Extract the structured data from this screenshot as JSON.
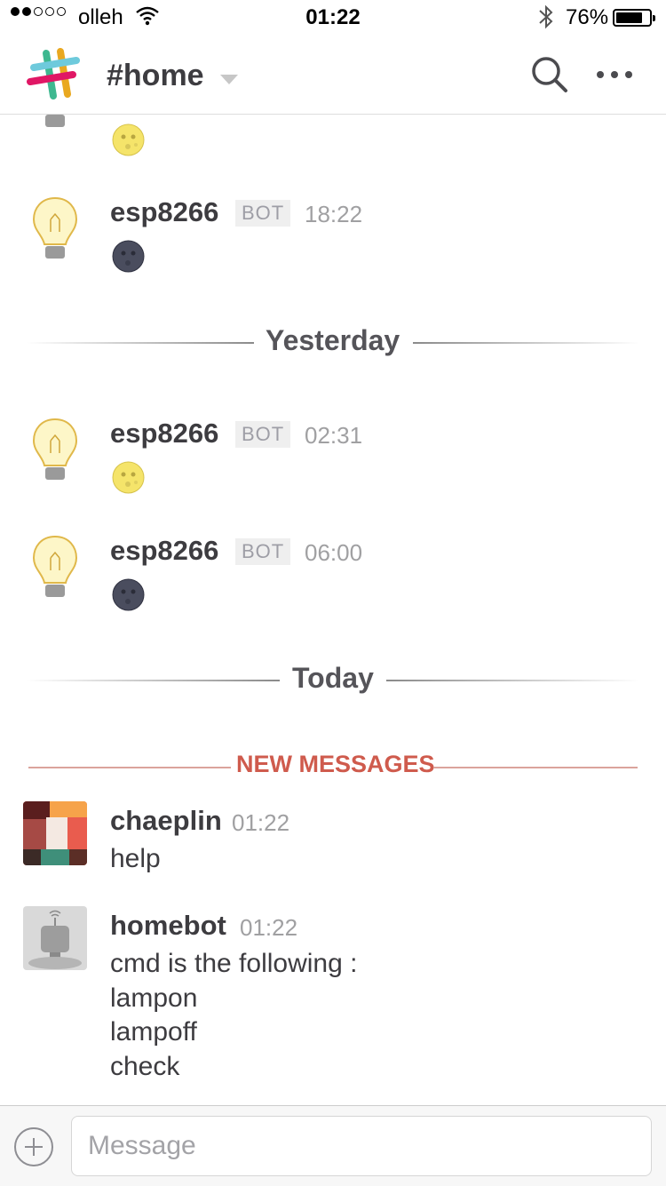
{
  "status_bar": {
    "signal_dots_filled": 2,
    "signal_dots_total": 5,
    "carrier": "olleh",
    "time": "01:22",
    "battery_percent": "76%",
    "battery_level": 0.76,
    "icons": [
      "wifi-icon",
      "bluetooth-icon",
      "battery-icon"
    ]
  },
  "header": {
    "channel": "#home",
    "icons": [
      "slack-logo",
      "chevron-down-icon",
      "search-icon",
      "more-icon"
    ]
  },
  "messages_top": [
    {
      "avatar": "lightbulb-icon",
      "emoji": "full-moon-face-icon"
    },
    {
      "name": "esp8266",
      "badge": "BOT",
      "time": "18:22",
      "avatar": "lightbulb-icon",
      "emoji": "new-moon-face-icon"
    }
  ],
  "dividers": {
    "yesterday": "Yesterday",
    "today": "Today",
    "new_messages": "NEW MESSAGES"
  },
  "messages_yesterday": [
    {
      "name": "esp8266",
      "badge": "BOT",
      "time": "02:31",
      "avatar": "lightbulb-icon",
      "emoji": "full-moon-face-icon"
    },
    {
      "name": "esp8266",
      "badge": "BOT",
      "time": "06:00",
      "avatar": "lightbulb-icon",
      "emoji": "new-moon-face-icon"
    }
  ],
  "messages_today": [
    {
      "name": "chaeplin",
      "time": "01:22",
      "text": "help",
      "avatar": "user-avatar"
    },
    {
      "name": "homebot",
      "time": "01:22",
      "avatar": "robot-avatar",
      "lines": [
        "cmd is the following :",
        "lampon",
        "lampoff",
        "check"
      ]
    }
  ],
  "composer": {
    "placeholder": "Message",
    "icons": [
      "add-icon"
    ]
  },
  "colors": {
    "text": "#3d3c40",
    "timestamp": "#a0a0a2",
    "new_messages": "#cf5b4d"
  }
}
